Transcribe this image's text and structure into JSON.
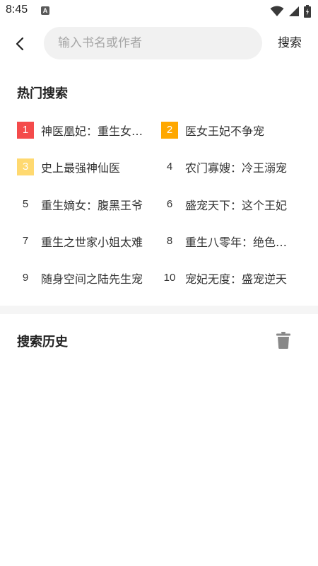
{
  "status_bar": {
    "time": "8:45",
    "notification_glyph": "A"
  },
  "search": {
    "placeholder": "输入书名或作者",
    "value": "",
    "submit_label": "搜索"
  },
  "hot_search": {
    "title": "热门搜索",
    "items": [
      {
        "rank": "1",
        "label": "神医凰妃：重生女帝很嚣张"
      },
      {
        "rank": "2",
        "label": "医女王妃不争宠"
      },
      {
        "rank": "3",
        "label": "史上最强神仙医"
      },
      {
        "rank": "4",
        "label": "农门寡嫂：冷王溺宠"
      },
      {
        "rank": "5",
        "label": "重生嫡女：腹黑王爷"
      },
      {
        "rank": "6",
        "label": "盛宠天下：这个王妃"
      },
      {
        "rank": "7",
        "label": "重生之世家小姐太难"
      },
      {
        "rank": "8",
        "label": "重生八零年：绝色娇妻"
      },
      {
        "rank": "9",
        "label": "随身空间之陆先生宠"
      },
      {
        "rank": "10",
        "label": "宠妃无度：盛宠逆天"
      }
    ]
  },
  "history": {
    "title": "搜索历史"
  },
  "colors": {
    "rank1": "#f44b4b",
    "rank2": "#ffa800",
    "rank3": "#ffd970",
    "search_bg": "#f1f1f1",
    "divider": "#f5f5f5"
  },
  "icons": {
    "back": "chevron-left-icon",
    "trash": "trash-icon",
    "wifi": "wifi-icon",
    "signal": "signal-icon",
    "battery": "battery-icon"
  }
}
